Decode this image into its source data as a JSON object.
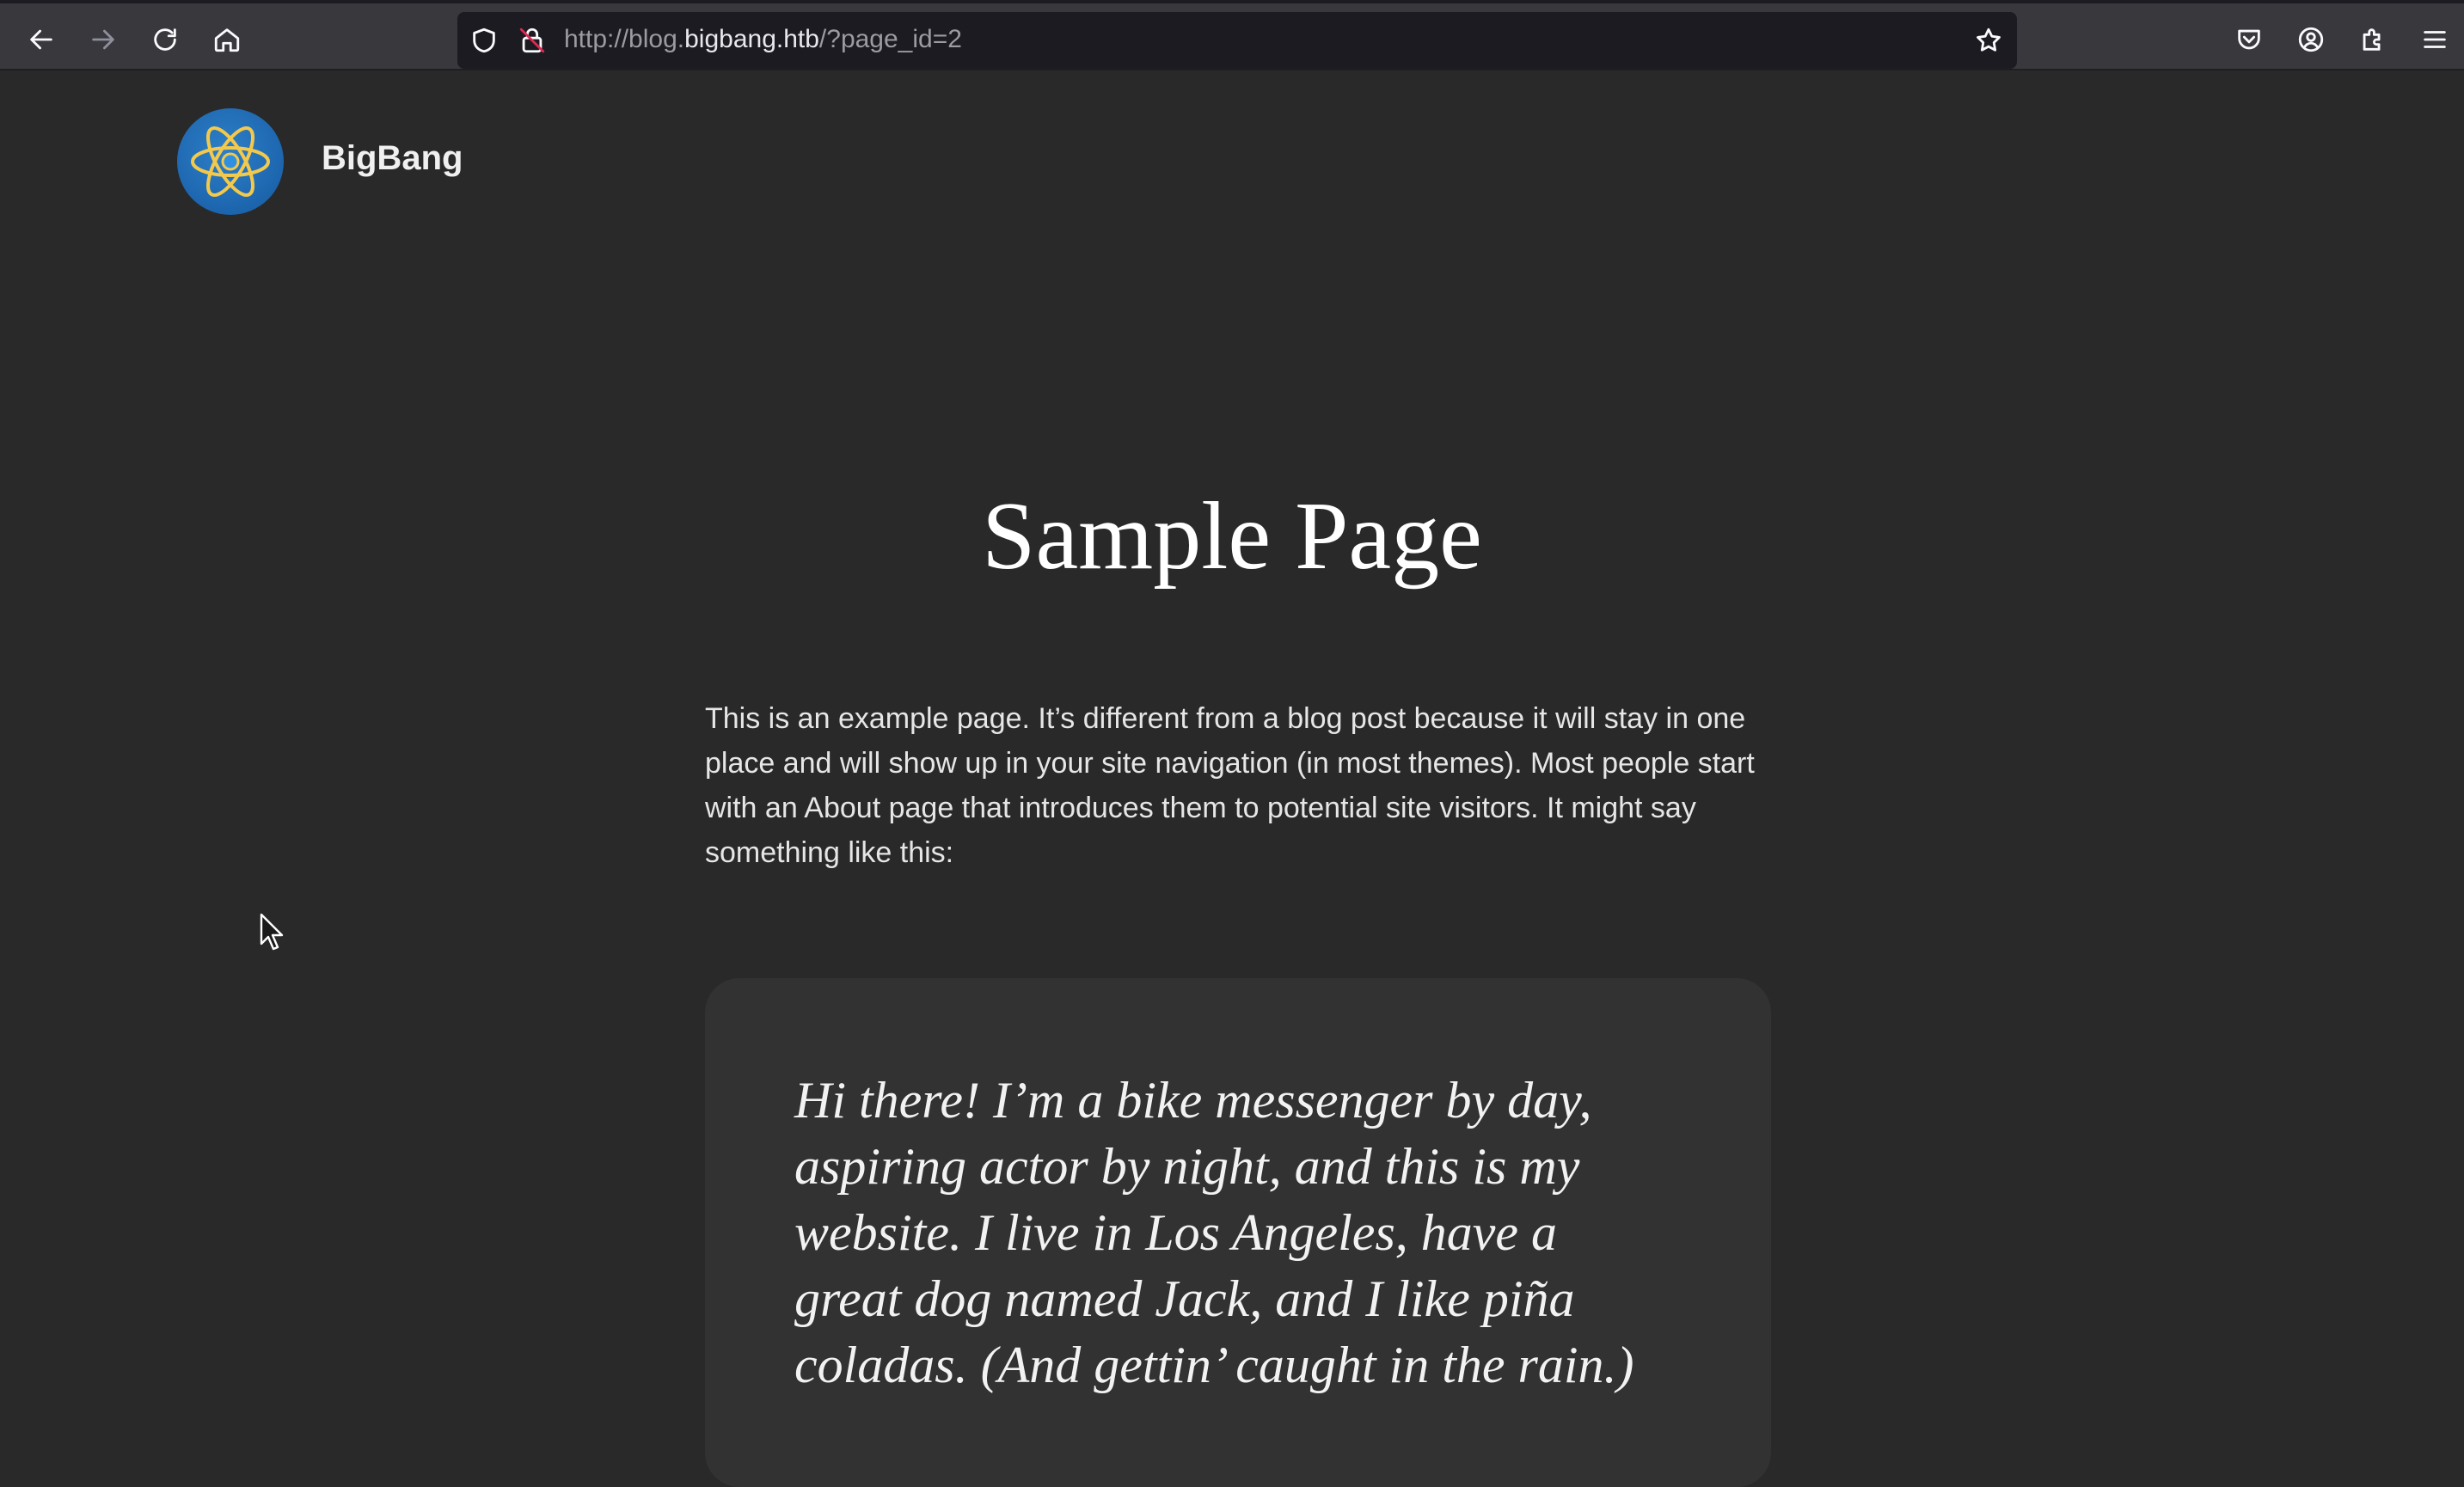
{
  "browser": {
    "url_prefix": "http://blog.",
    "url_host": "bigbang.htb",
    "url_path": "/?page_id=2"
  },
  "site": {
    "title": "BigBang"
  },
  "page": {
    "title": "Sample Page",
    "intro": "This is an example page. It’s different from a blog post because it will stay in one place and will show up in your site navigation (in most themes). Most people start with an About page that introduces them to potential site visitors. It might say something like this:",
    "quote": "Hi there! I’m a bike messenger by day, aspiring actor by night, and this is my website. I live in Los Angeles, have a great dog named Jack, and I like piña coladas. (And gettin’ caught in the rain.)"
  },
  "colors": {
    "page_background": "#292929",
    "quote_background": "#323232",
    "toolbar_background": "#38383d",
    "logo_blue": "#1f69b2",
    "logo_orbit": "#f2c94c"
  },
  "icons": [
    "back-arrow-icon",
    "forward-arrow-icon",
    "reload-icon",
    "home-icon",
    "shield-icon",
    "insecure-lock-icon",
    "bookmark-star-icon",
    "pocket-icon",
    "account-icon",
    "extensions-icon",
    "menu-icon",
    "atom-logo-icon",
    "mouse-cursor-icon"
  ]
}
